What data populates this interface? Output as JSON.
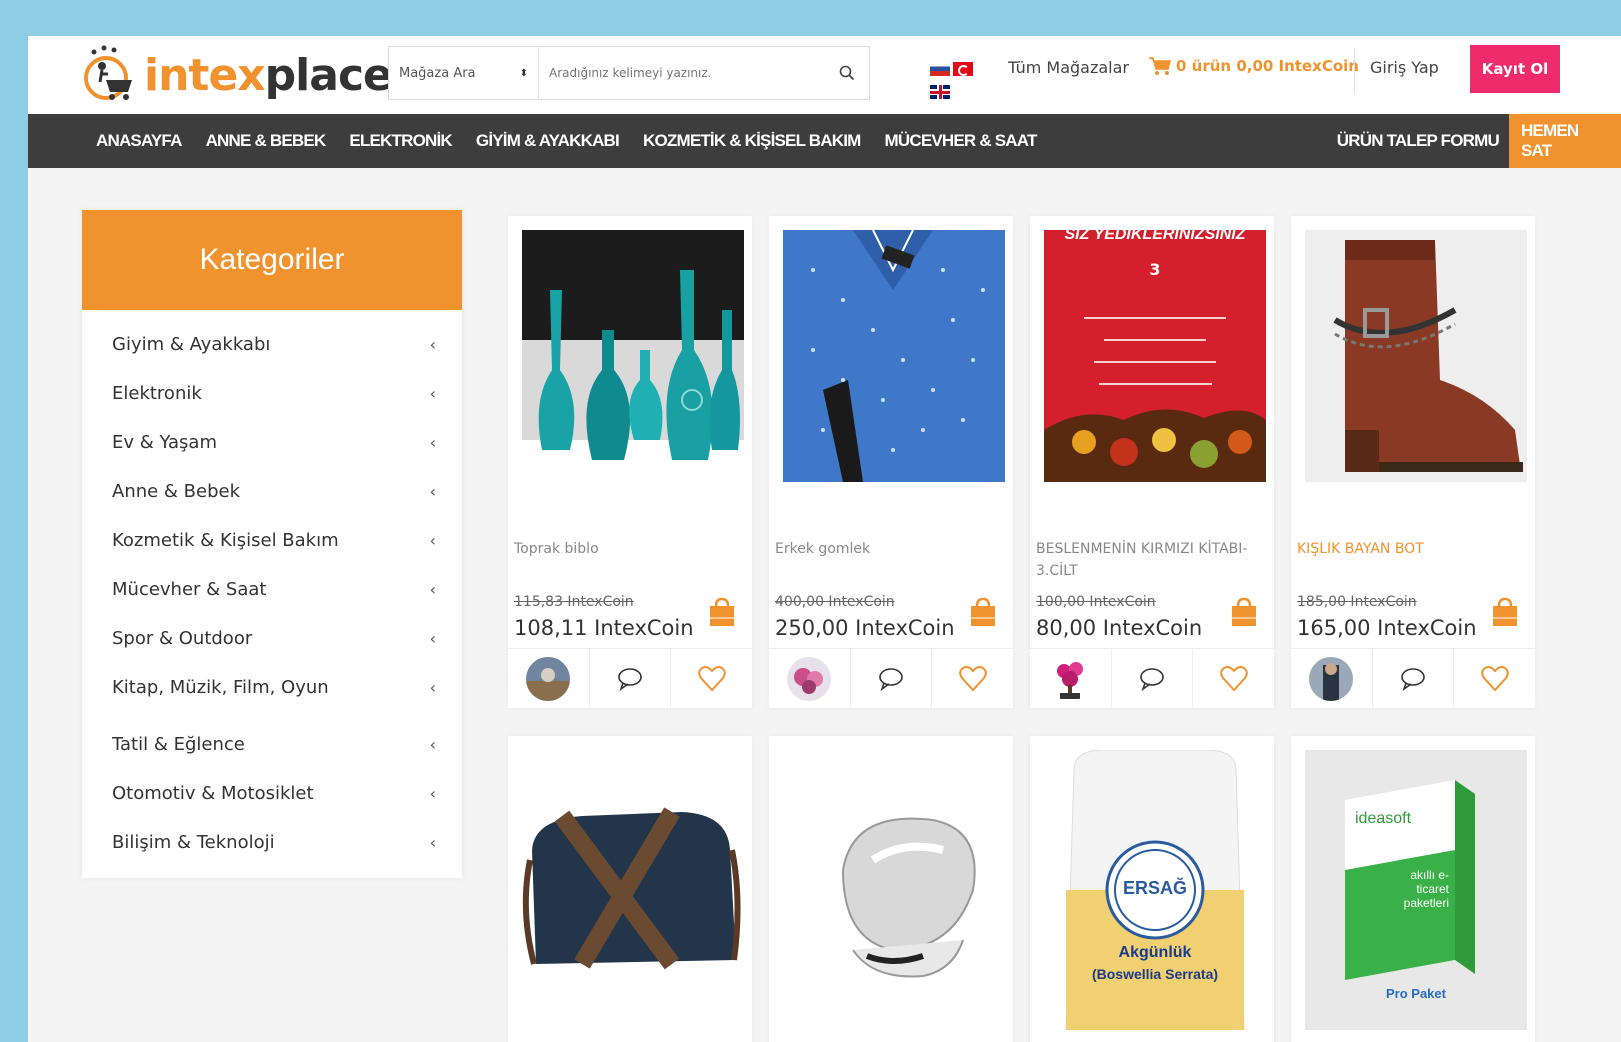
{
  "header": {
    "logo": {
      "part1": "intex",
      "part2": "place"
    },
    "search": {
      "store_label": "Mağaza Ara",
      "placeholder": "Aradığınız kelimeyi yazınız."
    },
    "all_stores": "Tüm Mağazalar",
    "cart_label": "0 ürün 0,00 IntexCoin",
    "login": "Giriş Yap",
    "register": "Kayıt Ol"
  },
  "nav": {
    "items": [
      "ANASAYFA",
      "ANNE & BEBEK",
      "ELEKTRONİK",
      "GİYİM & AYAKKABI",
      "KOZMETİK & KİŞİSEL BAKIM",
      "MÜCEVHER & SAAT"
    ],
    "request_form": "ÜRÜN TALEP FORMU",
    "sell_now": "HEMEN SAT"
  },
  "sidebar": {
    "title": "Kategoriler",
    "items": [
      "Giyim & Ayakkabı",
      "Elektronik",
      "Ev & Yaşam",
      "Anne & Bebek",
      "Kozmetik & Kişisel Bakım",
      "Mücevher & Saat",
      "Spor & Outdoor",
      "Kitap, Müzik, Film, Oyun",
      "Tatil & Eğlence",
      "Otomotiv & Motosiklet",
      "Bilişim & Teknoloji"
    ]
  },
  "products": [
    {
      "name": "Toprak biblo",
      "old_price": "115,83 IntexCoin",
      "price": "108,11 IntexCoin"
    },
    {
      "name": "Erkek gomlek",
      "old_price": "400,00 IntexCoin",
      "price": "250,00 IntexCoin"
    },
    {
      "name": "BESLENMENİN KIRMIZI KİTABI-3.CİLT",
      "old_price": "100,00 IntexCoin",
      "price": "80,00 IntexCoin",
      "cover_text": [
        "SİZ YEDİKLERİNİZSİNİZ",
        "3"
      ]
    },
    {
      "name": "KIŞLIK BAYAN BOT",
      "old_price": "185,00 IntexCoin",
      "price": "165,00 IntexCoin"
    }
  ],
  "products_row2": [
    {
      "label": ""
    },
    {
      "label": ""
    },
    {
      "label": "ERSAĞ",
      "sub": "Akgünlük",
      "sub2": "(Boswellia Serrata)"
    },
    {
      "label": "ideasoft",
      "sub": "akıllı e-ticaret paketleri",
      "sub2": "Pro Paket"
    }
  ],
  "colors": {
    "accent": "#f0922e",
    "register": "#ef2b6b",
    "nav_bg": "#3d3d3d",
    "page_bg": "#8ecde6"
  }
}
